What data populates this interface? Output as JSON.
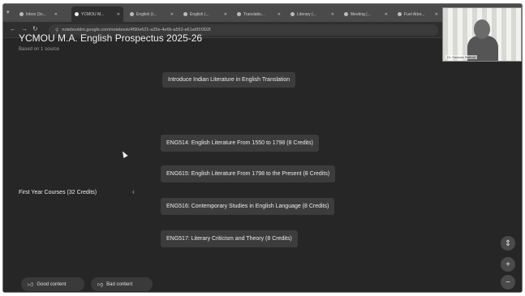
{
  "browser": {
    "tabs": [
      {
        "label": "Inbox (3s..."
      },
      {
        "label": "YCMOU M..."
      },
      {
        "label": "English (t..."
      },
      {
        "label": "English (..."
      },
      {
        "label": "Translatio..."
      },
      {
        "label": "Literary (..."
      },
      {
        "label": "Meeting (..."
      },
      {
        "label": "Fuel Attor..."
      }
    ],
    "url": "notebooklm.google.com/notebook/4f90e621-a25e-4e6b-a552-e61a6f1f302f"
  },
  "notebook": {
    "title": "YCMOU M.A. English Prospectus 2025-26",
    "sources": "Based on 1 source"
  },
  "mindmap": {
    "root": "First Year Courses (32 Credits)",
    "nodes": [
      "Introduce Indian Literature in English Translation",
      "ENG514: English Literature From 1550 to 1798 (8 Credits)",
      "ENG615: English Literature From 1798 to the Present (8 Credits)",
      "ENG516: Contemporary Studies in English Language (8 Credits)",
      "ENG517: Literary Criticism and Theory (8 Credits)"
    ]
  },
  "feedback": {
    "good": "Good content",
    "bad": "Bad content"
  },
  "webcam": {
    "name": "Dr. Santosh Rathod"
  },
  "icons": {
    "expand": "expand-icon",
    "download": "download-icon",
    "fit": "fit-view-icon",
    "zoom_in": "zoom-in-icon",
    "zoom_out": "zoom-out-icon"
  }
}
